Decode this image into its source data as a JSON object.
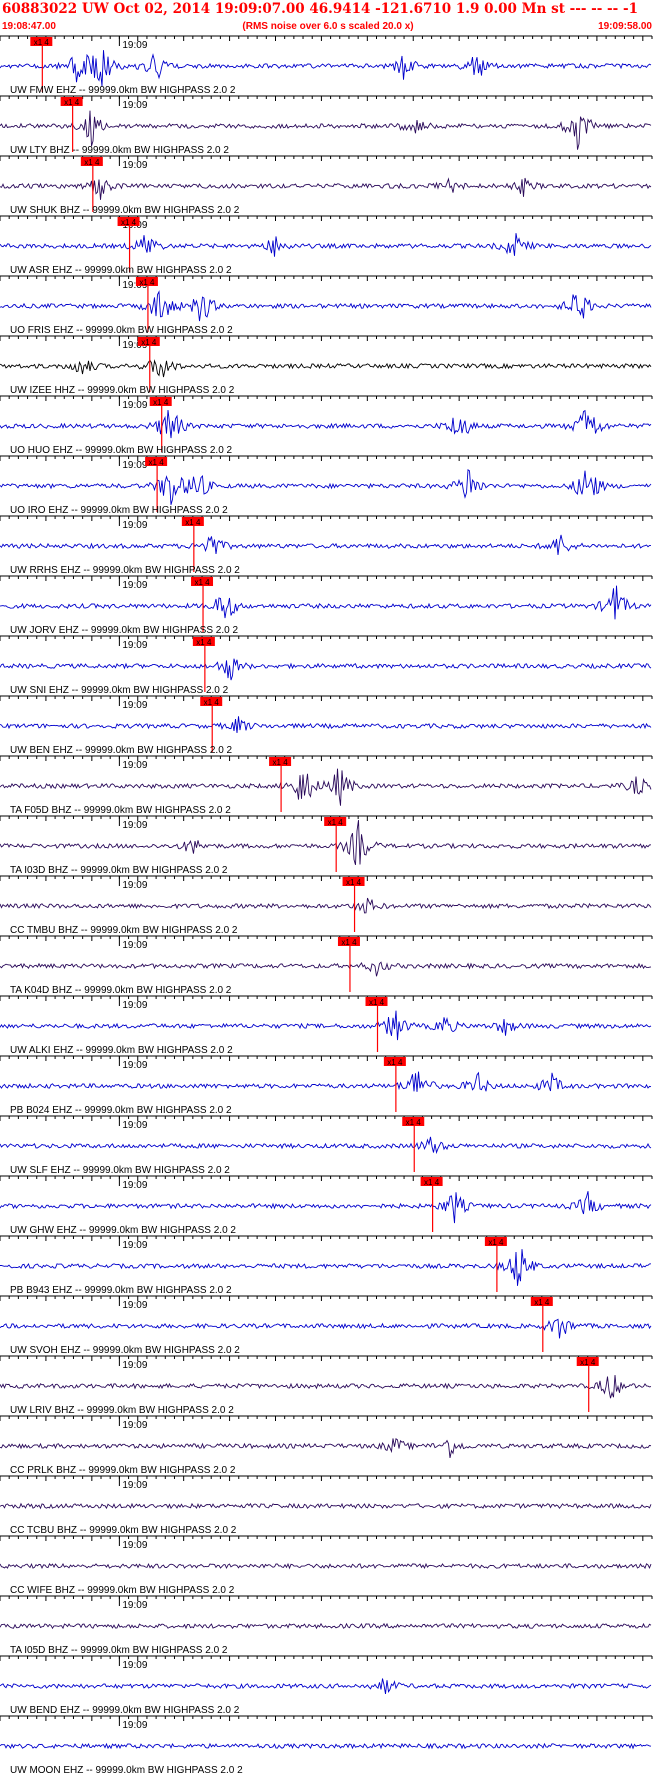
{
  "header": {
    "title": "60883022 UW Oct 02, 2014 19:09:07.00   46.9414 -121.6710  1.9 0.00 Mn st --- -- --  -1",
    "start_time": "19:08:47.00",
    "subtitle": "(RMS noise over 6.0 s scaled 20.0 x)",
    "end_time": "19:09:58.00"
  },
  "colors": {
    "header_text": "#ff0000",
    "pick_box": "#ff0000",
    "pick_text": "#000000",
    "trace_blue": "#0000cc",
    "trace_purple": "#2a0a5a",
    "trace_black": "#000000",
    "axis": "#000000"
  },
  "chart_data": {
    "type": "line",
    "title": "60883022 UW Oct 02, 2014 19:09:07.00   46.9414 -121.6710  1.9 0.00 Mn st --- -- --  -1",
    "subtitle": "(RMS noise over 6.0 s scaled 20.0 x)",
    "x_start": "19:08:47.00",
    "x_end": "19:09:58.00",
    "x_range_seconds": [
      0,
      71
    ],
    "tick_label": "19:09",
    "tick_label_seconds": 13,
    "pick_label": "x1 4",
    "traces": [
      {
        "label": "UW FMW EHZ -- 99999.0km BW  HIGHPASS  2.0  2",
        "color": "blue",
        "pick_s": 4.5,
        "bursts": [
          [
            8.5,
            1.0
          ],
          [
            11.0,
            1.2
          ],
          [
            17.0,
            0.9
          ],
          [
            44.0,
            0.6
          ],
          [
            52.0,
            0.7
          ]
        ]
      },
      {
        "label": "UW LTY BHZ -- 99999.0km BW  HIGHPASS  2.0  2",
        "color": "purple",
        "pick_s": 7.8,
        "bursts": [
          [
            10.0,
            0.9
          ],
          [
            45.0,
            0.5
          ],
          [
            63.0,
            1.2
          ]
        ]
      },
      {
        "label": "UW SHUK BHZ -- 99999.0km BW  HIGHPASS  2.0  2",
        "color": "purple",
        "pick_s": 10.0,
        "bursts": [
          [
            11.0,
            0.6
          ],
          [
            49.0,
            0.4
          ],
          [
            57.0,
            0.4
          ]
        ]
      },
      {
        "label": "UW ASR EHZ -- 99999.0km BW  HIGHPASS  2.0  2",
        "color": "blue",
        "pick_s": 14.0,
        "bursts": [
          [
            16.0,
            0.7
          ],
          [
            30.0,
            0.5
          ],
          [
            56.0,
            0.7
          ]
        ]
      },
      {
        "label": "UO FRIS EHZ -- 99999.0km BW  HIGHPASS  2.0  2",
        "color": "blue",
        "pick_s": 16.0,
        "bursts": [
          [
            17.5,
            1.1
          ],
          [
            22.0,
            0.9
          ],
          [
            63.0,
            1.0
          ]
        ]
      },
      {
        "label": "UW IZEE HHZ -- 99999.0km BW  HIGHPASS  2.0  2",
        "color": "black",
        "pick_s": 16.2,
        "bursts": [
          [
            9.0,
            0.5
          ],
          [
            17.5,
            0.8
          ]
        ]
      },
      {
        "label": "UO HUO EHZ -- 99999.0km BW  HIGHPASS  2.0  2",
        "color": "blue",
        "pick_s": 17.5,
        "bursts": [
          [
            18.5,
            1.2
          ],
          [
            50.0,
            0.9
          ],
          [
            64.0,
            1.3
          ]
        ]
      },
      {
        "label": "UO IRO EHZ -- 99999.0km BW  HIGHPASS  2.0  2",
        "color": "blue",
        "pick_s": 17.0,
        "bursts": [
          [
            18.5,
            1.2
          ],
          [
            21.5,
            0.9
          ],
          [
            51.0,
            1.0
          ],
          [
            64.0,
            1.3
          ]
        ]
      },
      {
        "label": "UW RRHS EHZ -- 99999.0km BW  HIGHPASS  2.0  2",
        "color": "blue",
        "pick_s": 21.0,
        "bursts": [
          [
            23.0,
            0.7
          ],
          [
            61.0,
            0.6
          ]
        ]
      },
      {
        "label": "UW JORV EHZ -- 99999.0km BW  HIGHPASS  2.0  2",
        "color": "blue",
        "pick_s": 22.0,
        "bursts": [
          [
            24.5,
            0.9
          ],
          [
            67.0,
            1.1
          ]
        ]
      },
      {
        "label": "UW SNI EHZ -- 99999.0km BW  HIGHPASS  2.0  2",
        "color": "blue",
        "pick_s": 22.2,
        "bursts": [
          [
            25.0,
            0.7
          ]
        ]
      },
      {
        "label": "UW BEN EHZ -- 99999.0km BW  HIGHPASS  2.0  2",
        "color": "blue",
        "pick_s": 23.0,
        "bursts": [
          [
            26.0,
            0.4
          ]
        ]
      },
      {
        "label": "TA F05D BHZ -- 99999.0km BW  HIGHPASS  2.0  2",
        "color": "purple",
        "pick_s": 30.5,
        "bursts": [
          [
            33.0,
            1.2
          ],
          [
            37.0,
            1.0
          ],
          [
            69.5,
            0.5
          ]
        ]
      },
      {
        "label": "TA I03D BHZ -- 99999.0km BW  HIGHPASS  2.0  2",
        "color": "purple",
        "pick_s": 36.5,
        "bursts": [
          [
            21.0,
            0.4
          ],
          [
            39.0,
            1.2
          ]
        ]
      },
      {
        "label": "CC TMBU BHZ -- 99999.0km BW  HIGHPASS  2.0  2",
        "color": "purple",
        "pick_s": 38.5,
        "bursts": [
          [
            40.0,
            0.4
          ]
        ]
      },
      {
        "label": "TA K04D BHZ -- 99999.0km BW  HIGHPASS  2.0  2",
        "color": "purple",
        "pick_s": 38.0,
        "bursts": [
          [
            41.0,
            0.4
          ]
        ]
      },
      {
        "label": "UW ALKI EHZ -- 99999.0km BW  HIGHPASS  2.0  2",
        "color": "blue",
        "pick_s": 41.0,
        "bursts": [
          [
            43.0,
            0.9
          ],
          [
            48.5,
            0.5
          ],
          [
            55.0,
            0.4
          ]
        ]
      },
      {
        "label": "PB B024 EHZ -- 99999.0km BW  HIGHPASS  2.0  2",
        "color": "blue",
        "pick_s": 43.0,
        "bursts": [
          [
            45.5,
            1.1
          ],
          [
            52.0,
            0.6
          ],
          [
            60.0,
            0.6
          ]
        ]
      },
      {
        "label": "UW SLF EHZ -- 99999.0km BW  HIGHPASS  2.0  2",
        "color": "blue",
        "pick_s": 45.0,
        "bursts": [
          [
            47.0,
            0.5
          ]
        ]
      },
      {
        "label": "UW GHW EHZ -- 99999.0km BW  HIGHPASS  2.0  2",
        "color": "blue",
        "pick_s": 47.0,
        "bursts": [
          [
            49.5,
            0.8
          ],
          [
            64.0,
            0.6
          ]
        ]
      },
      {
        "label": "PB B943 EHZ -- 99999.0km BW  HIGHPASS  2.0  2",
        "color": "blue",
        "pick_s": 54.0,
        "bursts": [
          [
            56.5,
            1.2
          ]
        ]
      },
      {
        "label": "UW SVOH EHZ -- 99999.0km BW  HIGHPASS  2.0  2",
        "color": "blue",
        "pick_s": 59.0,
        "bursts": [
          [
            61.0,
            0.7
          ]
        ]
      },
      {
        "label": "UW LRIV BHZ -- 99999.0km BW  HIGHPASS  2.0  2",
        "color": "purple",
        "pick_s": 64.0,
        "bursts": [
          [
            66.5,
            0.8
          ]
        ]
      },
      {
        "label": "CC PRLK BHZ -- 99999.0km BW  HIGHPASS  2.0  2",
        "color": "purple",
        "pick_s": null,
        "bursts": [
          [
            43.0,
            0.4
          ],
          [
            49.0,
            0.5
          ]
        ]
      },
      {
        "label": "CC TCBU BHZ -- 99999.0km BW  HIGHPASS  2.0  2",
        "color": "purple",
        "pick_s": null,
        "bursts": []
      },
      {
        "label": "CC WIFE BHZ -- 99999.0km BW  HIGHPASS  2.0  2",
        "color": "purple",
        "pick_s": null,
        "bursts": []
      },
      {
        "label": "TA I05D BHZ -- 99999.0km BW  HIGHPASS  2.0  2",
        "color": "purple",
        "pick_s": null,
        "bursts": []
      },
      {
        "label": "UW BEND EHZ -- 99999.0km BW  HIGHPASS  2.0  2",
        "color": "blue",
        "pick_s": null,
        "bursts": [
          [
            42.0,
            0.4
          ]
        ]
      },
      {
        "label": "UW MOON EHZ -- 99999.0km BW  HIGHPASS  2.0  2",
        "color": "blue",
        "pick_s": null,
        "bursts": []
      }
    ]
  }
}
